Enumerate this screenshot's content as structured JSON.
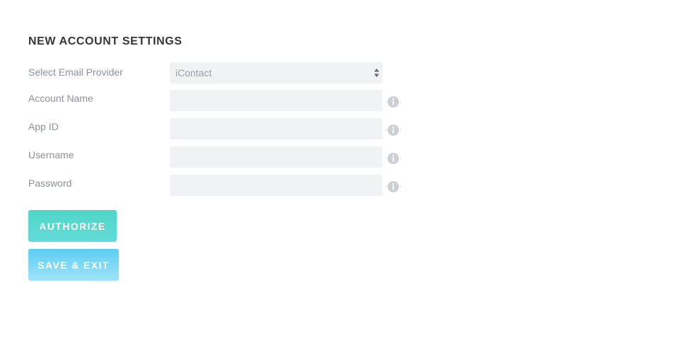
{
  "section": {
    "title": "NEW ACCOUNT SETTINGS"
  },
  "fields": {
    "provider": {
      "label": "Select Email Provider",
      "selected": "iContact"
    },
    "account_name": {
      "label": "Account Name",
      "value": ""
    },
    "app_id": {
      "label": "App ID",
      "value": ""
    },
    "username": {
      "label": "Username",
      "value": ""
    },
    "password": {
      "label": "Password",
      "value": ""
    }
  },
  "buttons": {
    "authorize": "AUTHORIZE",
    "save_exit": "SAVE & EXIT"
  },
  "icons": {
    "info": "info-icon",
    "select_arrows": "select-arrows-icon"
  },
  "colors": {
    "authorize_gradient": [
      "#4fd6c6",
      "#63dbd8"
    ],
    "save_gradient": [
      "#5ccdf0",
      "#a0e3fb"
    ],
    "field_background": "#f1f2f6",
    "label_text": "#8c939d",
    "title_text": "#32373c"
  }
}
